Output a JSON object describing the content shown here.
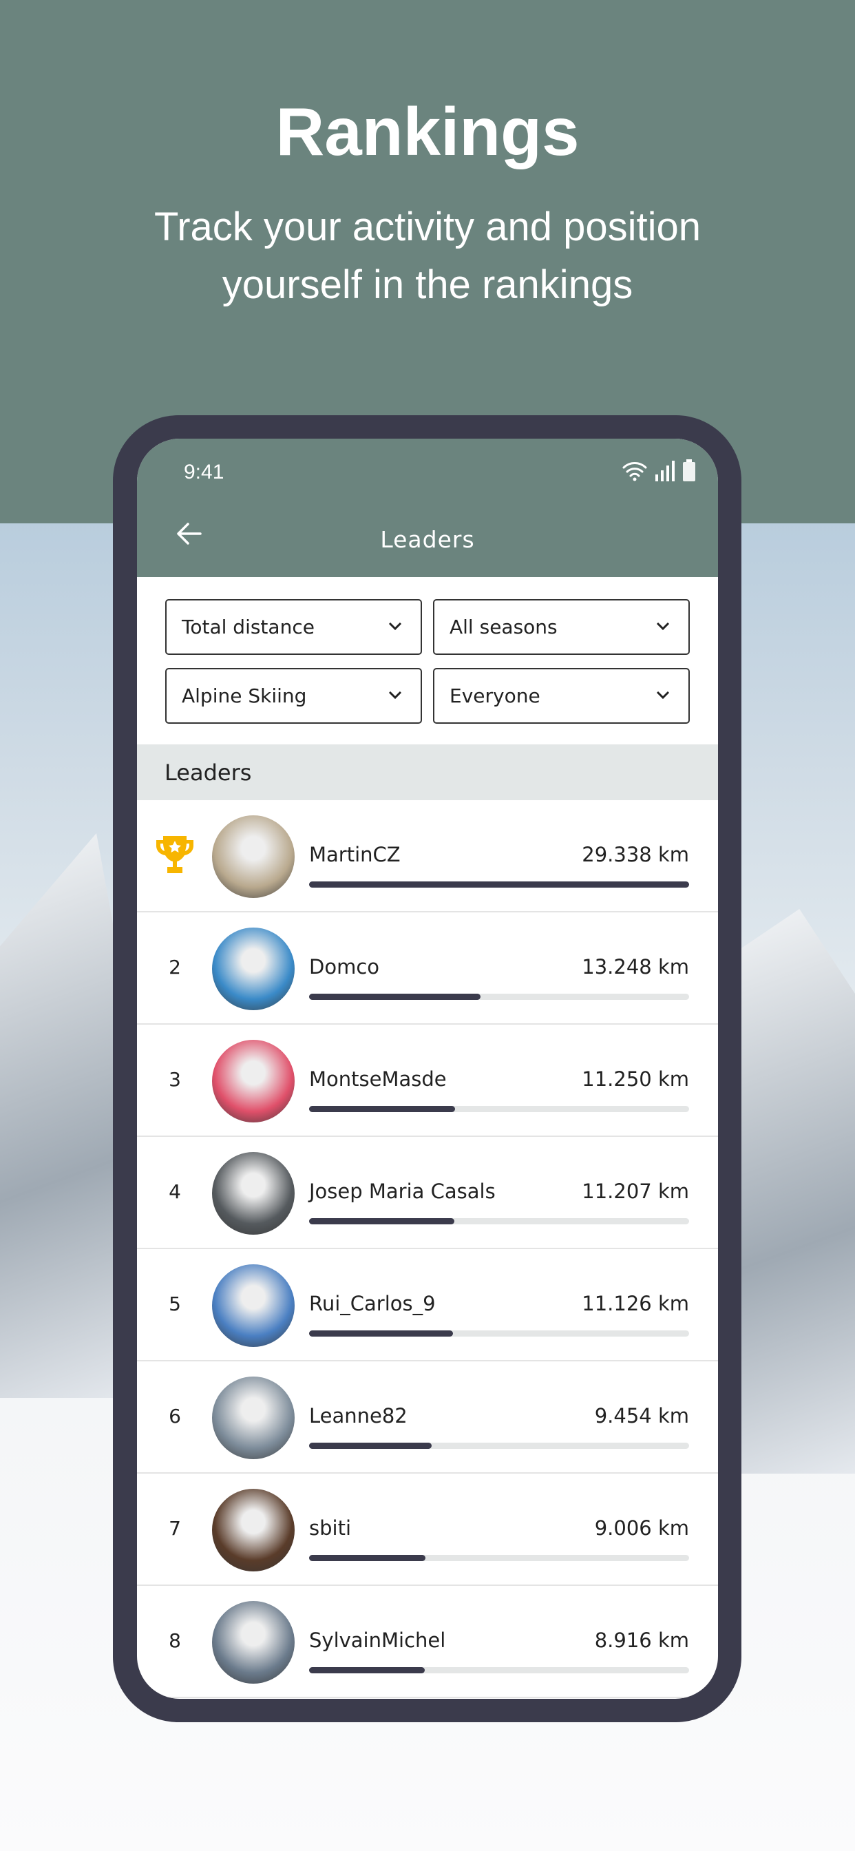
{
  "hero": {
    "title": "Rankings",
    "subtitle_line1": "Track your activity and position",
    "subtitle_line2": "yourself in the rankings"
  },
  "status_bar": {
    "time": "9:41",
    "icons": [
      "wifi-icon",
      "signal-icon",
      "battery-icon"
    ]
  },
  "app_bar": {
    "title": "Leaders",
    "back_icon": "arrow-left-icon"
  },
  "filters": [
    {
      "value": "Total distance"
    },
    {
      "value": "All seasons"
    },
    {
      "value": "Alpine Skiing"
    },
    {
      "value": "Everyone"
    }
  ],
  "section_title": "Leaders",
  "colors": {
    "header": "#6b847e",
    "frame": "#3b3b4c",
    "trophy": "#f7b500",
    "section_bg": "#e3e7e7"
  },
  "leaders": [
    {
      "rank": "1",
      "icon": "trophy-icon",
      "name": "MartinCZ",
      "distance": "29.338 km",
      "km": 29.338,
      "avatar": "#b9a98e"
    },
    {
      "rank": "2",
      "name": "Domco",
      "distance": "13.248 km",
      "km": 13.248,
      "avatar": "#3a8ac8"
    },
    {
      "rank": "3",
      "name": "MontseMasde",
      "distance": "11.250 km",
      "km": 11.25,
      "avatar": "#e0506a"
    },
    {
      "rank": "4",
      "name": "Josep Maria Casals",
      "distance": "11.207 km",
      "km": 11.207,
      "avatar": "#555a5e"
    },
    {
      "rank": "5",
      "name": "Rui_Carlos_9",
      "distance": "11.126 km",
      "km": 11.126,
      "avatar": "#4a7fc2"
    },
    {
      "rank": "6",
      "name": "Leanne82",
      "distance": "9.454 km",
      "km": 9.454,
      "avatar": "#7d8c9a"
    },
    {
      "rank": "7",
      "name": "sbiti",
      "distance": "9.006 km",
      "km": 9.006,
      "avatar": "#5a3c2a"
    },
    {
      "rank": "8",
      "name": "SylvainMichel",
      "distance": "8.916 km",
      "km": 8.916,
      "avatar": "#6b7b8c"
    }
  ]
}
